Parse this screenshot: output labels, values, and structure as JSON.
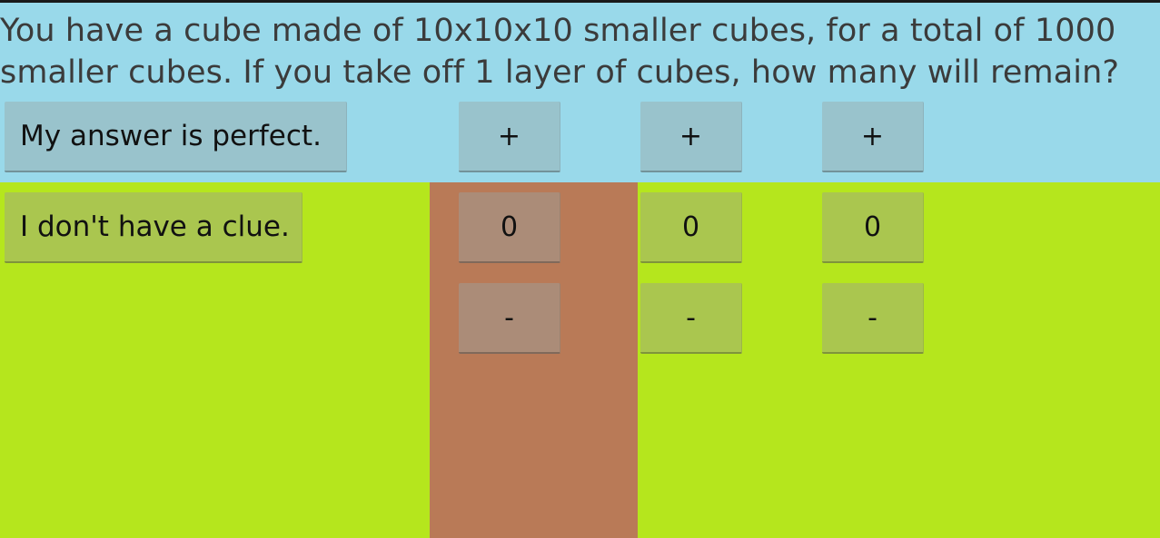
{
  "question": {
    "line1": "You have a cube made of 10x10x10 smaller cubes, for a total of 1000",
    "line2": "smaller cubes. If you take off 1 layer of cubes, how many will remain?"
  },
  "buttons": {
    "perfect_label": "My answer is perfect.",
    "clue_label": "I don't have a clue."
  },
  "digits": [
    {
      "plus": "+",
      "value": "0",
      "minus": "-",
      "selected": true
    },
    {
      "plus": "+",
      "value": "0",
      "minus": "-",
      "selected": false
    },
    {
      "plus": "+",
      "value": "0",
      "minus": "-",
      "selected": false
    }
  ],
  "colors": {
    "question_background": "#99d9ea",
    "answer_background": "#b5e61d",
    "selected_column": "#b97a57"
  }
}
